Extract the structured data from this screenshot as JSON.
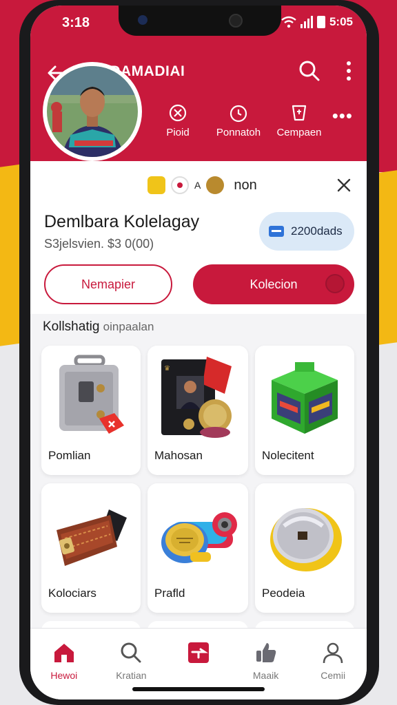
{
  "status_bar": {
    "time": "3:18",
    "battery_text": "5:05"
  },
  "header": {
    "title": "ANDAMADIAI"
  },
  "actions": [
    {
      "label": "Pioid",
      "icon": "target-icon"
    },
    {
      "label": "Ponnatoh",
      "icon": "timer-icon"
    },
    {
      "label": "Cempaen",
      "icon": "tag-icon"
    }
  ],
  "profile": {
    "badge_text": "non",
    "name": "Demlbara Kolelagay",
    "subtitle": "S3jelsvien.  $3 0(00)",
    "points": "2200dads",
    "secondary_button": "Nemapier",
    "primary_button": "Kolecion"
  },
  "section": {
    "title": "Kollshatig",
    "subtitle": "oinpaalan"
  },
  "items": [
    {
      "label": "Pomlian",
      "icon": "toolbox-icon"
    },
    {
      "label": "Mahosan",
      "icon": "card-pack-icon"
    },
    {
      "label": "Nolecitent",
      "icon": "crate-icon"
    },
    {
      "label": "Kolociars",
      "icon": "leather-case-icon"
    },
    {
      "label": "Prafld",
      "icon": "coin-stack-icon"
    },
    {
      "label": "Peodeia",
      "icon": "gold-coin-icon"
    }
  ],
  "bottom_nav": [
    {
      "label": "Hewoi",
      "icon": "home-icon",
      "active": true
    },
    {
      "label": "Kratian",
      "icon": "search-icon"
    },
    {
      "label": "",
      "icon": "ticket-icon"
    },
    {
      "label": "Maaik",
      "icon": "thumbs-up-icon"
    },
    {
      "label": "Cemii",
      "icon": "person-icon"
    }
  ],
  "colors": {
    "brand": "#c8193c",
    "accent": "#f3b814",
    "chip": "#dbe9f7"
  }
}
